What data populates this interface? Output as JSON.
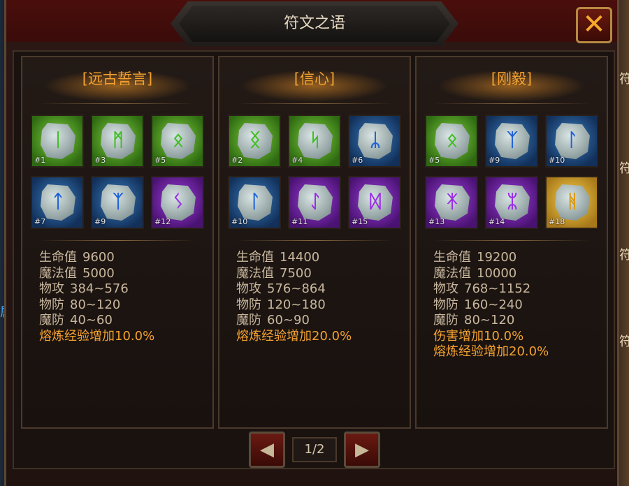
{
  "window": {
    "title": "符文之语",
    "close_icon": "close-x-icon"
  },
  "side": {
    "left_glyph": "属",
    "right_glyphs": [
      "符",
      "符",
      "符",
      "符"
    ]
  },
  "panels": [
    {
      "name": "[远古誓言]",
      "runes": [
        {
          "num": "#1",
          "color": "green",
          "glyph": "ᛁ"
        },
        {
          "num": "#3",
          "color": "green",
          "glyph": "ᛗ"
        },
        {
          "num": "#5",
          "color": "green",
          "glyph": "ᛟ"
        },
        {
          "num": "#7",
          "color": "blue",
          "glyph": "ᛏ"
        },
        {
          "num": "#9",
          "color": "blue",
          "glyph": "ᛉ"
        },
        {
          "num": "#12",
          "color": "purple",
          "glyph": "ᛊ"
        }
      ],
      "stats": [
        {
          "label": "生命值",
          "value": "9600"
        },
        {
          "label": "魔法值",
          "value": "5000"
        },
        {
          "label": "物攻",
          "value": "384~576"
        },
        {
          "label": "物防",
          "value": "80~120"
        },
        {
          "label": "魔防",
          "value": "40~60"
        }
      ],
      "bonuses": [
        "熔炼经验增加10.0%"
      ]
    },
    {
      "name": "[信心]",
      "runes": [
        {
          "num": "#2",
          "color": "green",
          "glyph": "ᛝ"
        },
        {
          "num": "#4",
          "color": "green",
          "glyph": "ᛋ"
        },
        {
          "num": "#6",
          "color": "blue",
          "glyph": "ᛦ"
        },
        {
          "num": "#10",
          "color": "blue",
          "glyph": "ᛚ"
        },
        {
          "num": "#11",
          "color": "purple",
          "glyph": "ᛇ"
        },
        {
          "num": "#15",
          "color": "purple",
          "glyph": "ᛞ"
        }
      ],
      "stats": [
        {
          "label": "生命值",
          "value": "14400"
        },
        {
          "label": "魔法值",
          "value": "7500"
        },
        {
          "label": "物攻",
          "value": "576~864"
        },
        {
          "label": "物防",
          "value": "120~180"
        },
        {
          "label": "魔防",
          "value": "60~90"
        }
      ],
      "bonuses": [
        "熔炼经验增加20.0%"
      ]
    },
    {
      "name": "[刚毅]",
      "runes": [
        {
          "num": "#5",
          "color": "green",
          "glyph": "ᛟ"
        },
        {
          "num": "#9",
          "color": "blue",
          "glyph": "ᛉ"
        },
        {
          "num": "#10",
          "color": "blue",
          "glyph": "ᛚ"
        },
        {
          "num": "#13",
          "color": "purple",
          "glyph": "ᛡ"
        },
        {
          "num": "#14",
          "color": "purple",
          "glyph": "ᛯ"
        },
        {
          "num": "#18",
          "color": "gold",
          "glyph": "ᚻ"
        }
      ],
      "stats": [
        {
          "label": "生命值",
          "value": "19200"
        },
        {
          "label": "魔法值",
          "value": "10000"
        },
        {
          "label": "物攻",
          "value": "768~1152"
        },
        {
          "label": "物防",
          "value": "160~240"
        },
        {
          "label": "魔防",
          "value": "80~120"
        }
      ],
      "bonuses": [
        "伤害增加10.0%",
        "熔炼经验增加20.0%"
      ]
    }
  ],
  "pager": {
    "label": "1/2",
    "prev_icon": "chevron-left-icon",
    "next_icon": "chevron-right-icon",
    "prev_glyph": "◀",
    "next_glyph": "▶"
  },
  "colors": {
    "accent": "#f4a230",
    "stat_text": "#c9b89e",
    "green": "#3fbe22",
    "blue": "#1f62d8",
    "purple": "#9a2ee6",
    "gold": "#d89a14"
  }
}
